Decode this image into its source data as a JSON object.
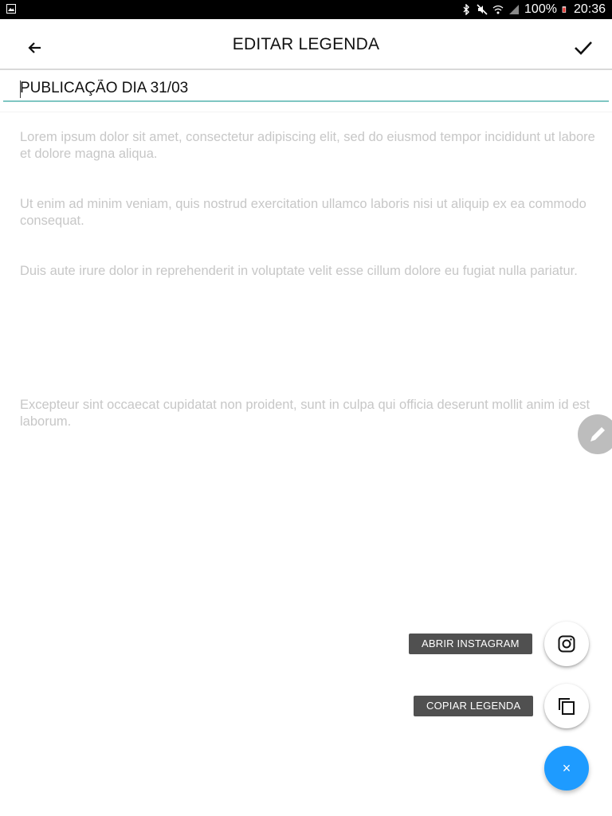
{
  "status_bar": {
    "battery": "100%",
    "time": "20:36",
    "icons": [
      "image-icon",
      "bluetooth-icon",
      "mute-icon",
      "wifi-icon",
      "signal-icon",
      "battery-icon"
    ]
  },
  "app_bar": {
    "title": "EDITAR LEGENDA",
    "back_icon": "arrow-left-icon",
    "confirm_icon": "check-icon"
  },
  "editor": {
    "title_value": "PUBLICAÇÃO DIA 31/03",
    "paragraphs": [
      "Lorem ipsum dolor sit amet, consectetur adipiscing elit, sed do eiusmod tempor incididunt ut labore et dolore magna aliqua.",
      "Ut enim ad minim veniam, quis nostrud exercitation ullamco laboris nisi ut aliquip ex ea commodo consequat.",
      "Duis aute irure dolor in reprehenderit in voluptate velit esse cillum dolore eu fugiat nulla pariatur.",
      "Excepteur sint occaecat cupidatat non proident, sunt in culpa qui officia deserunt mollit anim id est laborum."
    ]
  },
  "fab_menu": {
    "open_instagram_label": "ABRIR INSTAGRAM",
    "copy_caption_label": "COPIAR LEGENDA",
    "close_symbol": "×"
  },
  "colors": {
    "accent": "#1e9bff",
    "input_underline": "#7fc6c2",
    "placeholder_text": "#c7c7c7",
    "label_bg": "#505050"
  }
}
